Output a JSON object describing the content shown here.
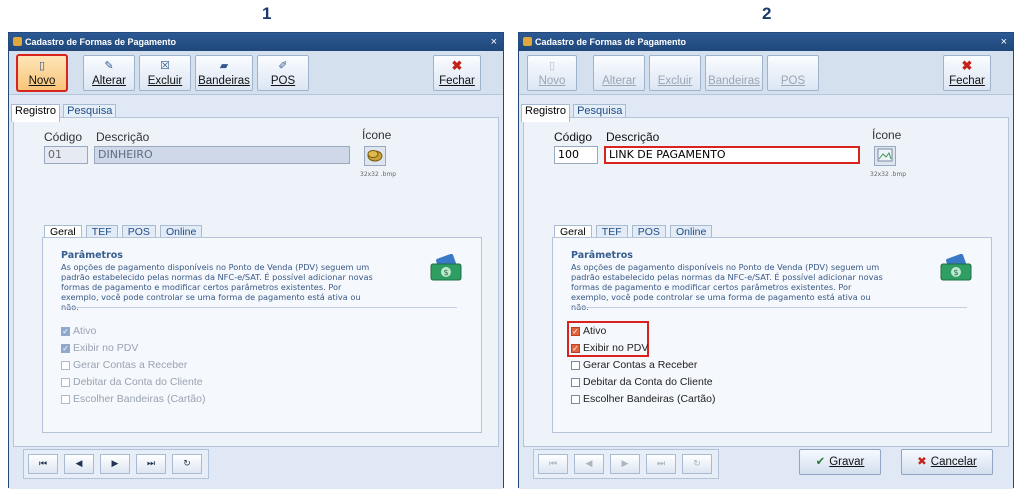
{
  "steps": [
    "1",
    "2"
  ],
  "window": {
    "title": "Cadastro de Formas de Pagamento",
    "close": "×"
  },
  "toolbar": {
    "novo": "Novo",
    "alterar": "Alterar",
    "excluir": "Excluir",
    "bandeiras": "Bandeiras",
    "pos": "POS",
    "fechar": "Fechar"
  },
  "tabs": [
    "Registro",
    "Pesquisa"
  ],
  "labels": {
    "codigo": "Código",
    "descricao": "Descrição",
    "icone": "Ícone",
    "icon_size": "32x32 .bmp"
  },
  "screen1": {
    "codigo": "01",
    "descricao": "DINHEIRO"
  },
  "screen2": {
    "codigo": "100",
    "descricao": "LINK DE PAGAMENTO"
  },
  "inner_tabs": [
    "Geral",
    "TEF",
    "POS",
    "Online"
  ],
  "parametros": {
    "title": "Parâmetros",
    "text": "As opções de pagamento disponíveis no Ponto de Venda (PDV) seguem um padrão estabelecido pelas normas da NFC-e/SAT. É possível adicionar novas formas de pagamento e modificar certos parâmetros existentes. Por exemplo, você pode controlar se uma forma de pagamento está ativa ou não."
  },
  "checkboxes": [
    "Ativo",
    "Exibir no PDV",
    "Gerar Contas a Receber",
    "Debitar da Conta do Cliente",
    "Escolher Bandeiras (Cartão)"
  ],
  "nav": [
    "⏮",
    "◀",
    "▶",
    "⏭",
    "↻"
  ],
  "actions": {
    "gravar": "Gravar",
    "cancelar": "Cancelar"
  },
  "colors": {
    "highlight": "#d9231f",
    "title_bar": "#1f477a"
  }
}
